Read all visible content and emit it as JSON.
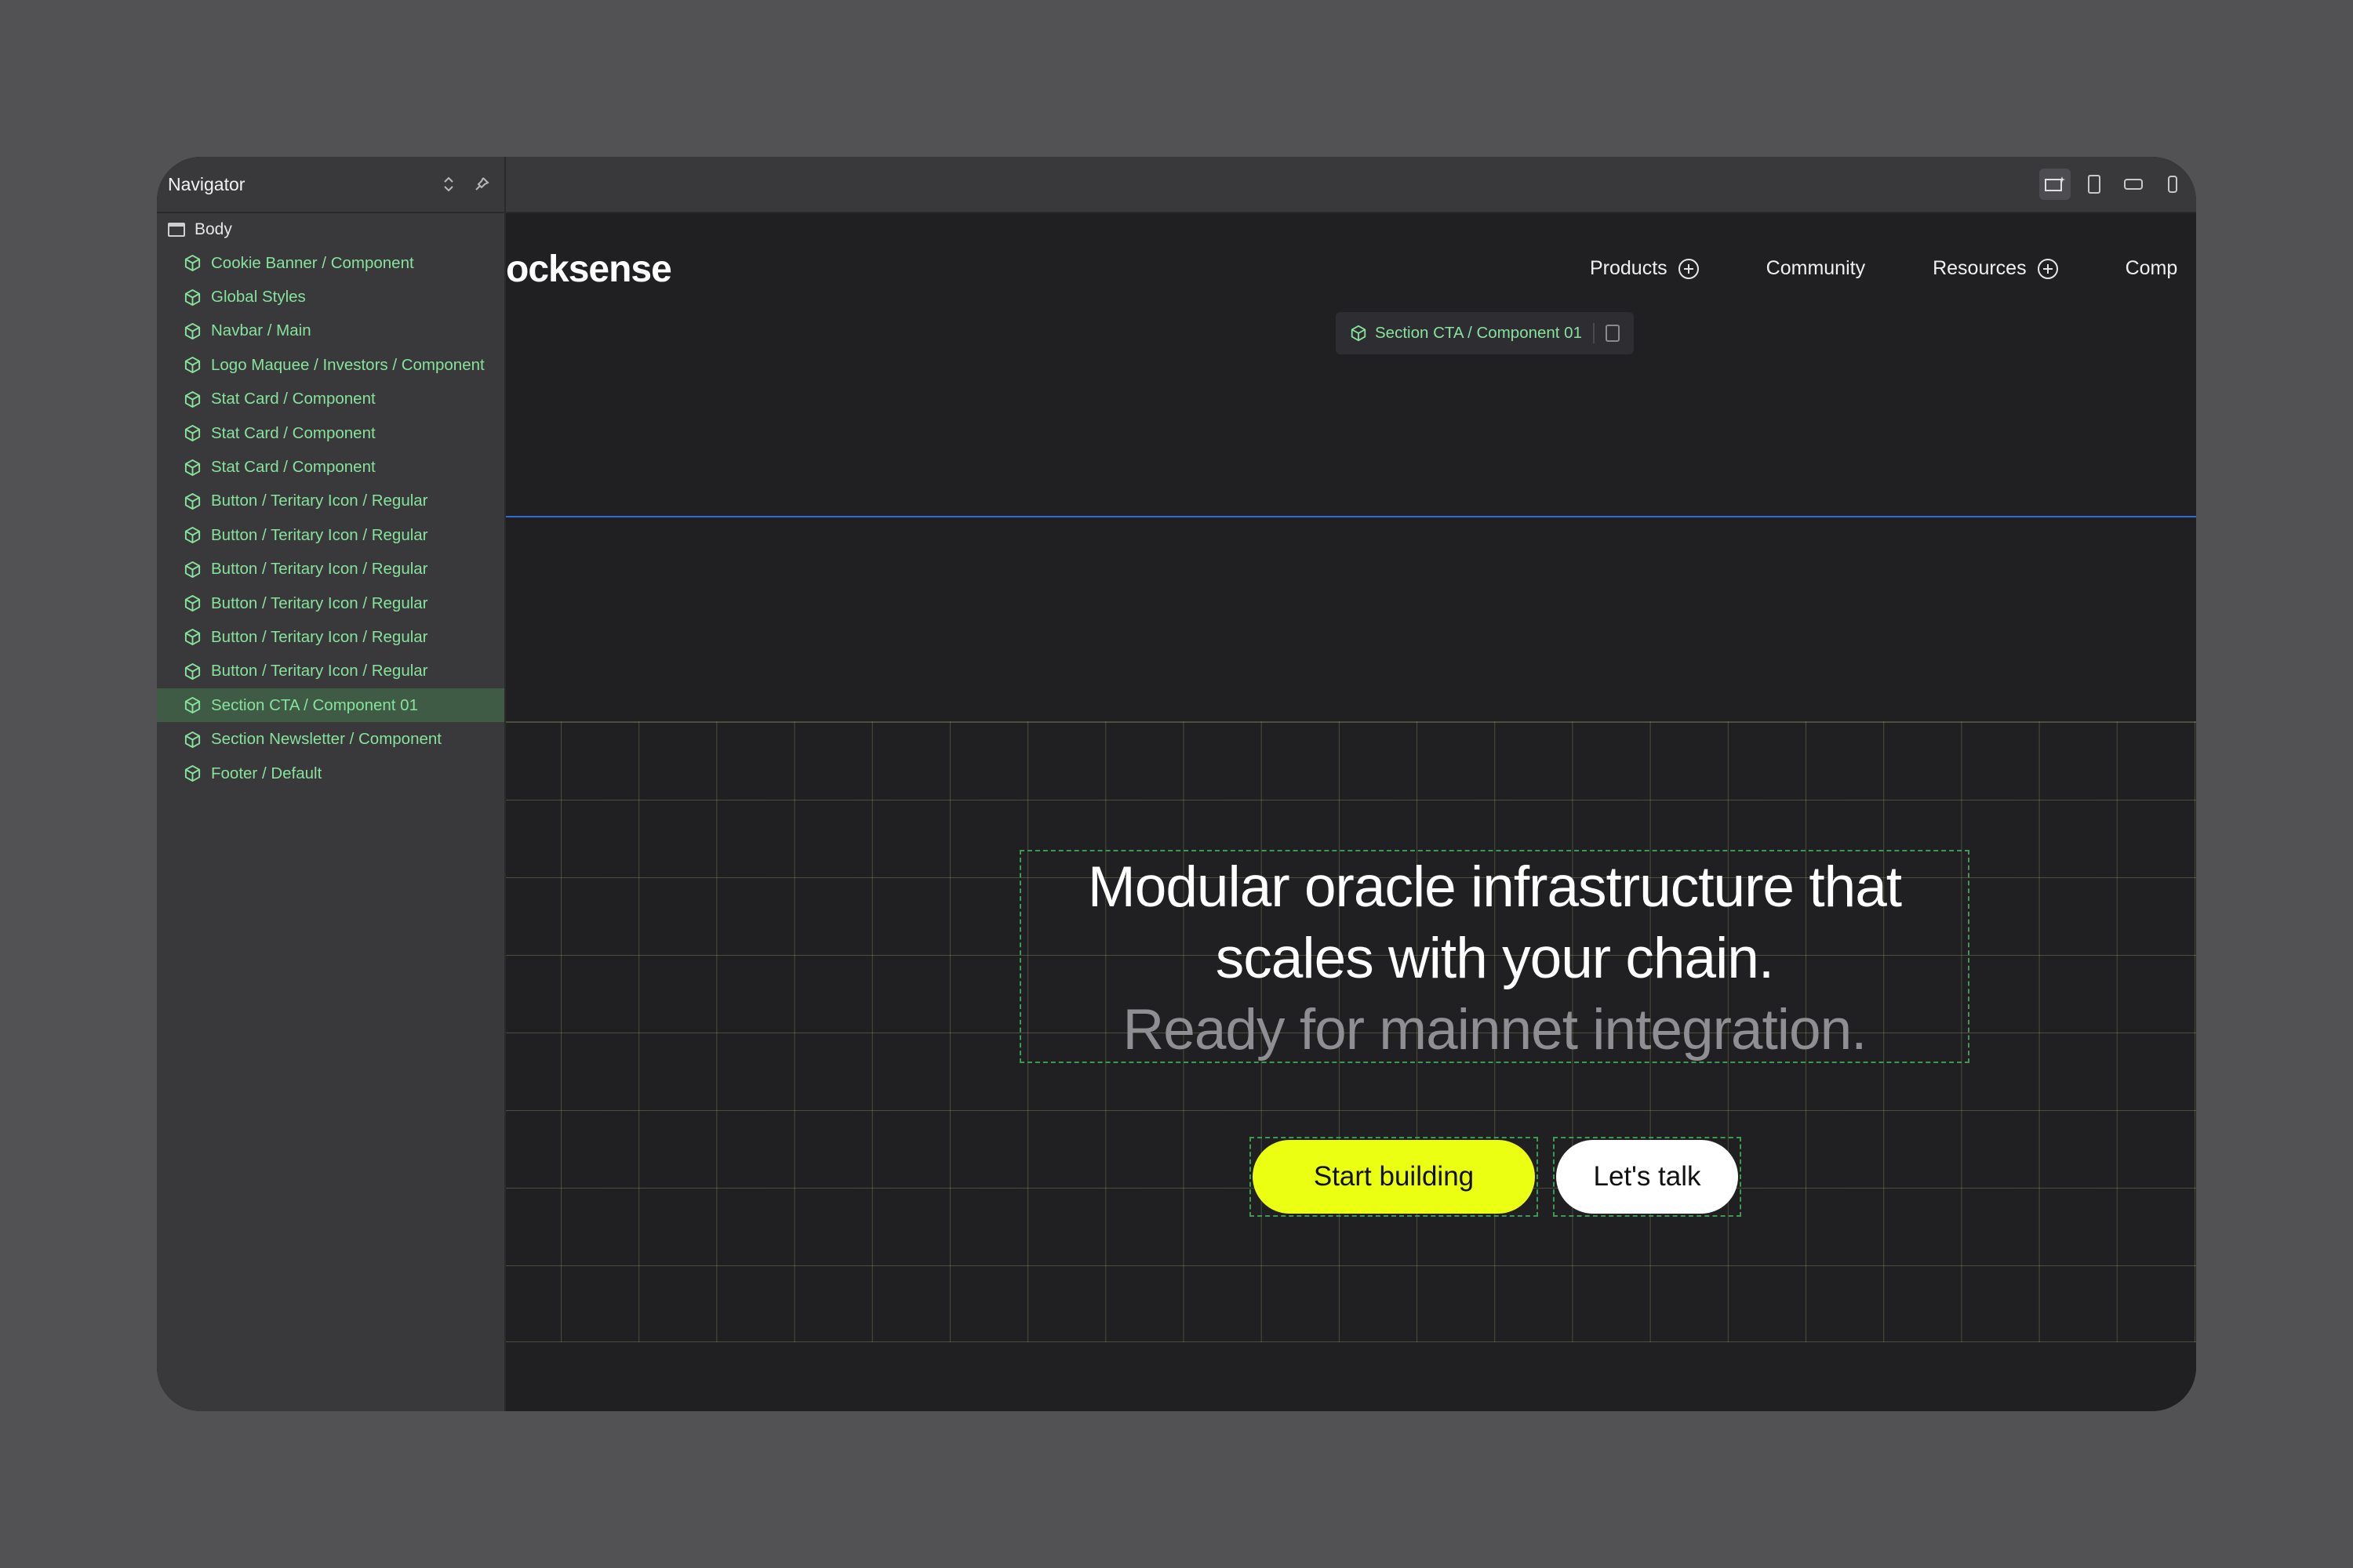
{
  "navigator": {
    "title": "Navigator",
    "root": "Body",
    "items": [
      {
        "label": "Cookie Banner / Component",
        "selected": false
      },
      {
        "label": "Global Styles",
        "selected": false
      },
      {
        "label": "Navbar / Main",
        "selected": false
      },
      {
        "label": "Logo Maquee / Investors / Component",
        "selected": false
      },
      {
        "label": "Stat Card / Component",
        "selected": false
      },
      {
        "label": "Stat Card / Component",
        "selected": false
      },
      {
        "label": "Stat Card / Component",
        "selected": false
      },
      {
        "label": "Button / Teritary Icon / Regular",
        "selected": false
      },
      {
        "label": "Button / Teritary Icon / Regular",
        "selected": false
      },
      {
        "label": "Button / Teritary Icon / Regular",
        "selected": false
      },
      {
        "label": "Button / Teritary Icon / Regular",
        "selected": false
      },
      {
        "label": "Button / Teritary Icon / Regular",
        "selected": false
      },
      {
        "label": "Button / Teritary Icon / Regular",
        "selected": false
      },
      {
        "label": "Section CTA / Component 01",
        "selected": true
      },
      {
        "label": "Section Newsletter / Component",
        "selected": false
      },
      {
        "label": "Footer / Default",
        "selected": false
      }
    ],
    "item_icon": "component-cube-icon",
    "header_icons": [
      "sort-arrows-icon",
      "pin-icon"
    ]
  },
  "toolbar": {
    "breakpoints": [
      "desktop-star-icon",
      "tablet-icon",
      "landscape-phone-icon",
      "phone-icon"
    ]
  },
  "site": {
    "logo": "ocksense",
    "nav": [
      {
        "label": "Products",
        "has_plus": true
      },
      {
        "label": "Community",
        "has_plus": false
      },
      {
        "label": "Resources",
        "has_plus": true
      },
      {
        "label": "Comp",
        "has_plus": false
      }
    ]
  },
  "selection_tag": {
    "label": "Section CTA / Component 01",
    "icon": "component-cube-icon",
    "action_icon": "trash-icon"
  },
  "hero": {
    "line1": "Modular oracle infrastructure that",
    "line2": "scales with your chain.",
    "line3": "Ready for mainnet integration.",
    "primary_button": "Start building",
    "secondary_button": "Let's talk"
  },
  "colors": {
    "accent": "#ebff12",
    "selection_green": "#86e39b",
    "guide_blue": "#2f6bd3",
    "canvas_bg": "#201f22",
    "panel_bg": "#39383b"
  }
}
